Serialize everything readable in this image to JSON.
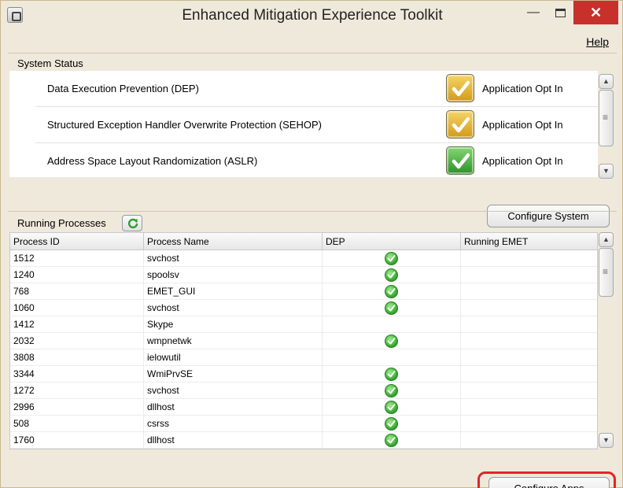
{
  "window": {
    "title": "Enhanced Mitigation Experience Toolkit",
    "minimize_glyph": "—",
    "close_glyph": "✕"
  },
  "menu": {
    "help_label": "Help"
  },
  "system_status": {
    "title": "System Status",
    "rows": [
      {
        "feature": "Data Execution Prevention (DEP)",
        "status": "Application Opt In",
        "indicator": "yellow-check-icon"
      },
      {
        "feature": "Structured Exception Handler Overwrite Protection (SEHOP)",
        "status": "Application Opt In",
        "indicator": "yellow-check-icon"
      },
      {
        "feature": "Address Space Layout Randomization (ASLR)",
        "status": "Application Opt In",
        "indicator": "green-check-icon"
      }
    ],
    "configure_button": "Configure System"
  },
  "running_processes": {
    "title": "Running Processes",
    "columns": [
      "Process ID",
      "Process Name",
      "DEP",
      "Running EMET"
    ],
    "rows": [
      {
        "pid": "1512",
        "name": "svchost",
        "dep": true,
        "emet": ""
      },
      {
        "pid": "1240",
        "name": "spoolsv",
        "dep": true,
        "emet": ""
      },
      {
        "pid": "768",
        "name": "EMET_GUI",
        "dep": true,
        "emet": ""
      },
      {
        "pid": "1060",
        "name": "svchost",
        "dep": true,
        "emet": ""
      },
      {
        "pid": "1412",
        "name": "Skype",
        "dep": false,
        "emet": ""
      },
      {
        "pid": "2032",
        "name": "wmpnetwk",
        "dep": true,
        "emet": ""
      },
      {
        "pid": "3808",
        "name": "ielowutil",
        "dep": false,
        "emet": ""
      },
      {
        "pid": "3344",
        "name": "WmiPrvSE",
        "dep": true,
        "emet": ""
      },
      {
        "pid": "1272",
        "name": "svchost",
        "dep": true,
        "emet": ""
      },
      {
        "pid": "2996",
        "name": "dllhost",
        "dep": true,
        "emet": ""
      },
      {
        "pid": "508",
        "name": "csrss",
        "dep": true,
        "emet": ""
      },
      {
        "pid": "1760",
        "name": "dllhost",
        "dep": true,
        "emet": ""
      }
    ],
    "configure_button": "Configure Apps"
  },
  "colors": {
    "highlight": "#e3242b",
    "close_button": "#c7312b",
    "window_bg": "#efe9dc"
  }
}
